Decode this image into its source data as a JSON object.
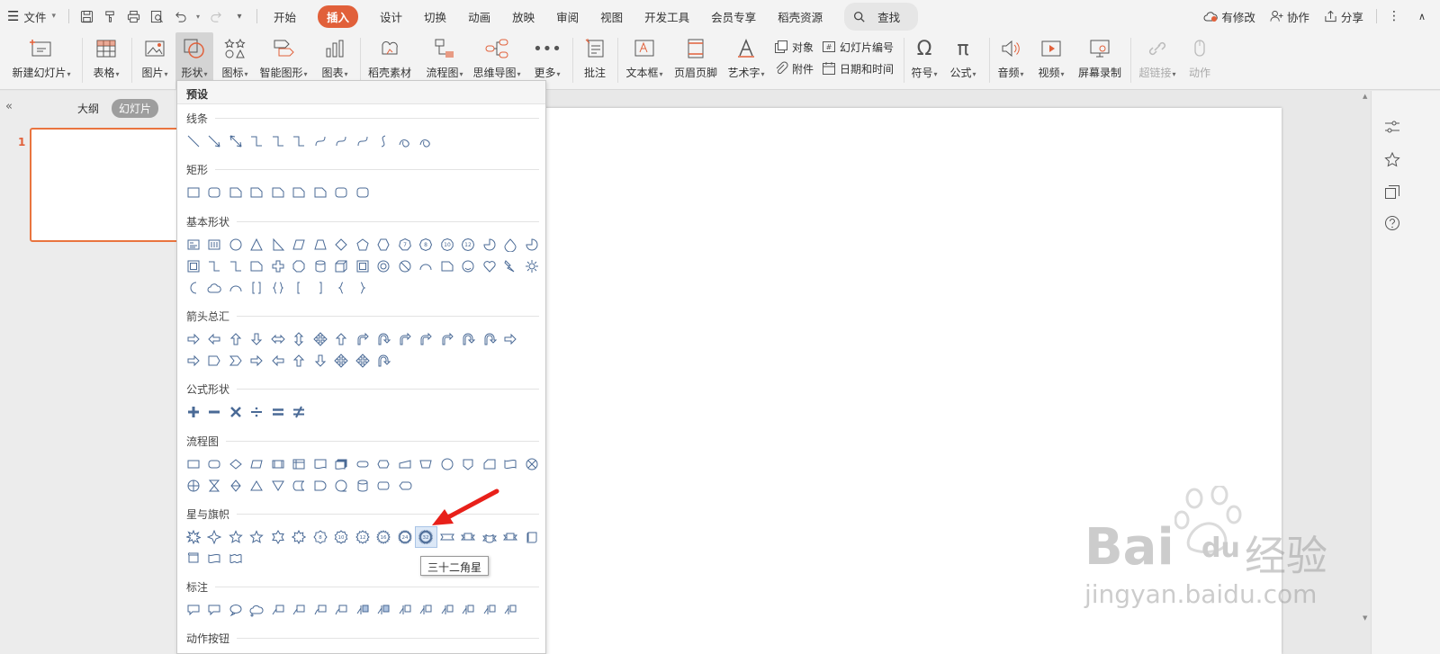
{
  "menubar": {
    "file_label": "文件",
    "tabs": [
      "开始",
      "插入",
      "设计",
      "切换",
      "动画",
      "放映",
      "审阅",
      "视图",
      "开发工具",
      "会员专享",
      "稻壳资源"
    ],
    "active_tab": "插入",
    "search_label": "查找",
    "right": {
      "changes": "有修改",
      "collab": "协作",
      "share": "分享"
    }
  },
  "ribbon": {
    "new_slide": "新建幻灯片",
    "table": "表格",
    "picture": "图片",
    "shape": "形状",
    "icon": "图标",
    "smartart": "智能图形",
    "chart": "图表",
    "docer": "稻壳素材",
    "flowchart": "流程图",
    "mindmap": "思维导图",
    "more": "更多",
    "comment": "批注",
    "textbox": "文本框",
    "header_footer": "页眉页脚",
    "wordart": "艺术字",
    "object": "对象",
    "attachment": "附件",
    "slide_number": "幻灯片编号",
    "datetime": "日期和时间",
    "symbol": "符号",
    "formula": "公式",
    "audio": "音频",
    "video": "视频",
    "screen_record": "屏幕录制",
    "hyperlink": "超链接",
    "action": "动作"
  },
  "left_panel": {
    "outline": "大纲",
    "slides": "幻灯片",
    "slide_number": "1"
  },
  "shapes_dropdown": {
    "title": "预设",
    "categories": [
      "线条",
      "矩形",
      "基本形状",
      "箭头总汇",
      "公式形状",
      "流程图",
      "星与旗帜",
      "标注",
      "动作按钮"
    ],
    "tooltip": "三十二角星"
  },
  "watermark": {
    "brand": "Bai",
    "brand2": "du",
    "suffix": "经验",
    "url": "jingyan.baidu.com"
  },
  "colors": {
    "accent": "#e1603a",
    "highlight": "#dce8f7",
    "arrow": "#e8201a"
  }
}
